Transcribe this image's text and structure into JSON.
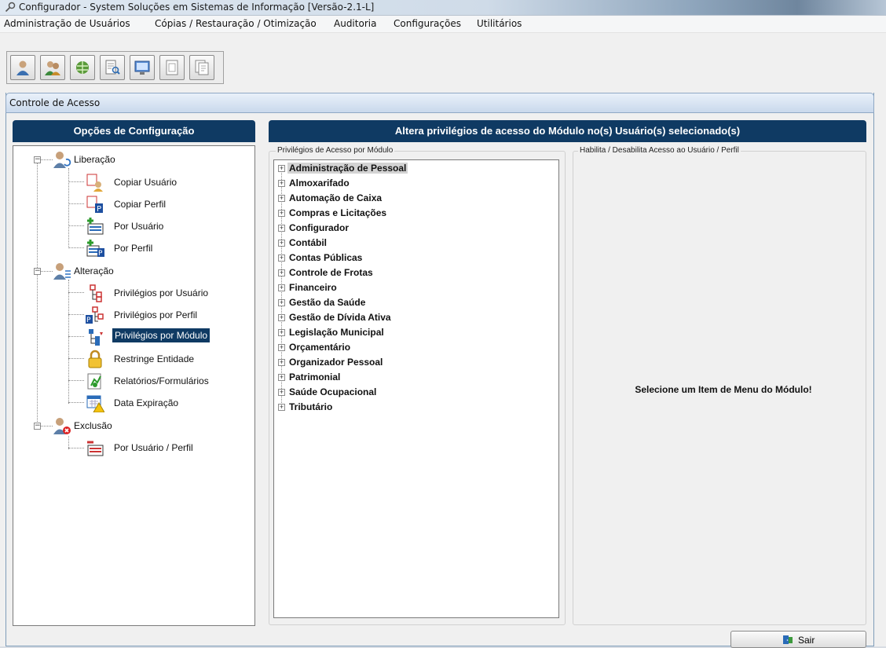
{
  "window": {
    "title": "Configurador - System Soluções em Sistemas de Informação [Versão-2.1-L]"
  },
  "menu": [
    "Administração de Usuários",
    "Cópias / Restauração / Otimização",
    "Auditoria",
    "Configurações",
    "Utilitários"
  ],
  "toolbar": [
    "user-icon",
    "users-icon",
    "network-icon",
    "document-search-icon",
    "monitor-icon",
    "page-icon",
    "page-copy-icon"
  ],
  "panel": {
    "title": "Controle de Acesso"
  },
  "left": {
    "header": "Opções de Configuração",
    "groups": [
      {
        "label": "Liberação",
        "items": [
          "Copiar Usuário",
          "Copiar Perfil",
          "Por Usuário",
          "Por Perfil"
        ]
      },
      {
        "label": "Alteração",
        "items": [
          "Privilégios por Usuário",
          "Privilégios por Perfil",
          "Privilégios por Módulo",
          "Restringe Entidade",
          "Relatórios/Formulários",
          "Data Expiração"
        ]
      },
      {
        "label": "Exclusão",
        "items": [
          "Por Usuário / Perfil"
        ]
      }
    ]
  },
  "main": {
    "header": "Altera privilégios de acesso do Módulo no(s) Usuário(s) selecionado(s)",
    "modules_group": "Privilégios de Acesso por Módulo",
    "modules": [
      "Administração de Pessoal",
      "Almoxarifado",
      "Automação de Caixa",
      "Compras e Licitações",
      "Configurador",
      "Contábil",
      "Contas Públicas",
      "Controle de Frotas",
      "Financeiro",
      "Gestão da Saúde",
      "Gestão de Dívida Ativa",
      "Legislação Municipal",
      "Orçamentário",
      "Organizador Pessoal",
      "Patrimonial",
      "Saúde Ocupacional",
      "Tributário"
    ],
    "access_group": "Habilita / Desabilita Acesso ao Usuário / Perfil",
    "message": "Selecione um Item de Menu do Módulo!"
  },
  "buttons": {
    "exit": "Sair"
  },
  "colors": {
    "header_band": "#0f3a63",
    "selection": "#0f3a63"
  }
}
